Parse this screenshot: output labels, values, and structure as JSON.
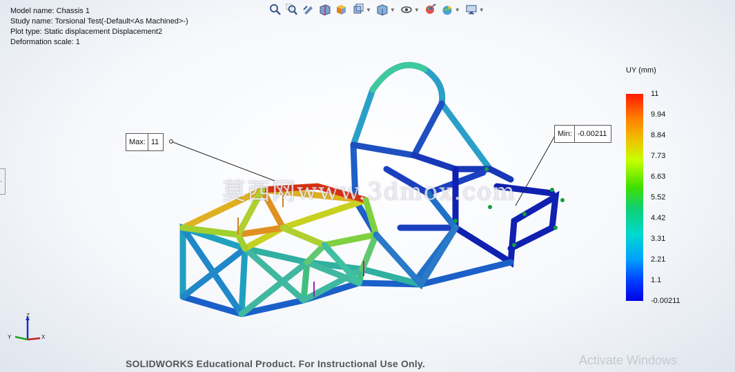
{
  "info": {
    "model": "Model name: Chassis 1",
    "study": "Study name: Torsional Test(-Default<As Machined>-)",
    "plot": "Plot type: Static displacement Displacement2",
    "deformation": "Deformation scale: 1"
  },
  "toolbar": {
    "icons": [
      "zoom-to-fit-icon",
      "zoom-to-area-icon",
      "previous-view-icon",
      "section-view-icon",
      "view-selector-icon",
      "view-orientation-icon",
      "display-style-icon",
      "hide-show-items-icon",
      "edit-appearance-icon",
      "apply-scene-icon",
      "view-settings-icon"
    ]
  },
  "legend": {
    "title": "UY (mm)",
    "ticks": [
      "11",
      "9.94",
      "8.84",
      "7.73",
      "6.63",
      "5.52",
      "4.42",
      "3.31",
      "2.21",
      "1.1",
      "-0.00211"
    ],
    "colors": {
      "max": "#ff1a00",
      "mid": "#40e000",
      "min": "#0000e6"
    }
  },
  "max_callout": {
    "label": "Max:",
    "value": "11"
  },
  "min_callout": {
    "label": "Min:",
    "value": "-0.00211"
  },
  "watermark": "莫西网www.3dmox.com",
  "triad": {
    "x": "X",
    "y": "Y",
    "z": "Z"
  },
  "footer": "SOLIDWORKS Educational Product. For Instructional Use Only.",
  "activate": "Activate Windows"
}
